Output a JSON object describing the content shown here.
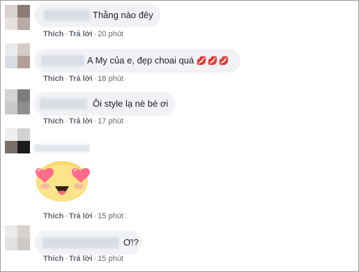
{
  "comments": [
    {
      "text": "Thằng nào đêy",
      "actions": {
        "like": "Thích",
        "reply": "Trả lời",
        "time": "20 phút"
      }
    },
    {
      "text": "A My của e, đẹp choai quá",
      "emoji": "💋💋💋",
      "actions": {
        "like": "Thích",
        "reply": "Trả lời",
        "time": "18 phút"
      }
    },
    {
      "text": "Ôi style lạ nè bé ơi",
      "actions": {
        "like": "Thích",
        "reply": "Trả lời",
        "time": "17 phút"
      }
    },
    {
      "sticker": "heart-eyes-face",
      "actions": {
        "like": "Thích",
        "reply": "Trả lời",
        "time": "15 phút"
      }
    },
    {
      "text": "Ơ!?",
      "actions": {
        "like": "Thích",
        "reply": "Trả lời",
        "time": "15 phút"
      }
    }
  ],
  "separator": "·",
  "colors": {
    "bubble": "#f0f2f5",
    "text": "#1c1e21",
    "meta": "#606770",
    "lips": "#e0245e"
  }
}
